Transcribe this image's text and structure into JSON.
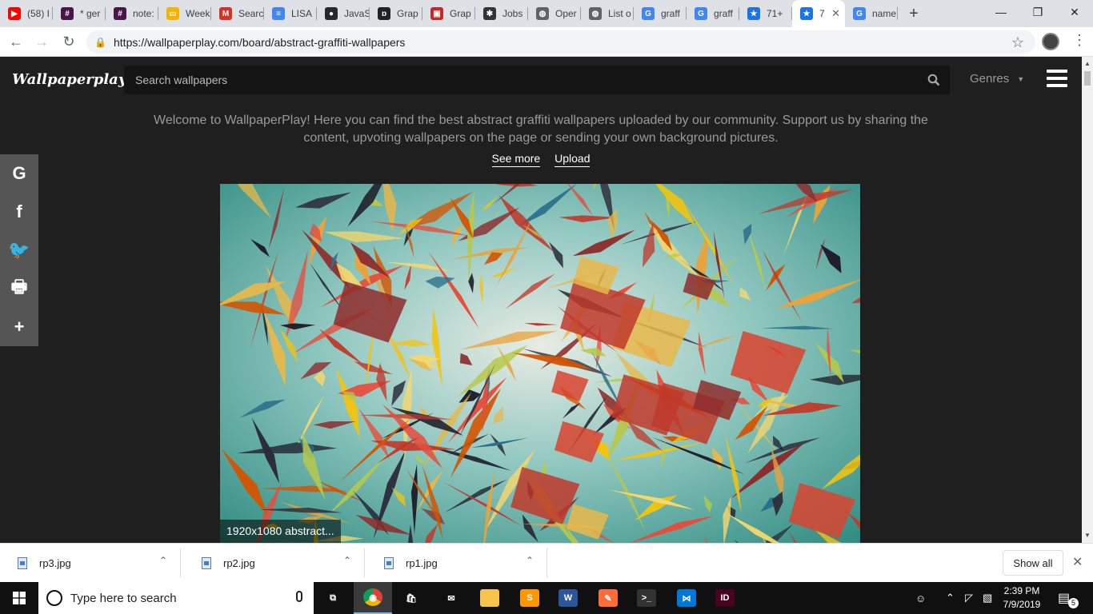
{
  "browser": {
    "tabs": [
      {
        "label": "(58) I",
        "fav_color": "#ff0000",
        "fav_icon": "youtube-icon",
        "fav_glyph": "▶"
      },
      {
        "label": "* ger",
        "fav_color": "#4a154b",
        "fav_icon": "slack-icon",
        "fav_glyph": "#"
      },
      {
        "label": "note:",
        "fav_color": "#4a154b",
        "fav_icon": "slack-icon",
        "fav_glyph": "#"
      },
      {
        "label": "Week",
        "fav_color": "#f4b400",
        "fav_icon": "slides-icon",
        "fav_glyph": "▭"
      },
      {
        "label": "Searc",
        "fav_color": "#d93025",
        "fav_icon": "gmail-icon",
        "fav_glyph": "M"
      },
      {
        "label": "LISA",
        "fav_color": "#4285f4",
        "fav_icon": "docs-icon",
        "fav_glyph": "≡"
      },
      {
        "label": "JavaS",
        "fav_color": "#24292e",
        "fav_icon": "github-icon",
        "fav_glyph": "●"
      },
      {
        "label": "Grap",
        "fav_color": "#222222",
        "fav_icon": "graph-icon",
        "fav_glyph": "ɒ"
      },
      {
        "label": "Grap",
        "fav_color": "#c62828",
        "fav_icon": "graph-icon",
        "fav_glyph": "▣"
      },
      {
        "label": "Jobs",
        "fav_color": "#333333",
        "fav_icon": "jobs-icon",
        "fav_glyph": "✱"
      },
      {
        "label": "Oper",
        "fav_color": "#5f6368",
        "fav_icon": "globe-icon",
        "fav_glyph": "◍"
      },
      {
        "label": "List o",
        "fav_color": "#5f6368",
        "fav_icon": "globe-icon",
        "fav_glyph": "◍"
      },
      {
        "label": "graff",
        "fav_color": "#4285f4",
        "fav_icon": "google-icon",
        "fav_glyph": "G"
      },
      {
        "label": "graff",
        "fav_color": "#4285f4",
        "fav_icon": "google-icon",
        "fav_glyph": "G"
      },
      {
        "label": "71+",
        "fav_color": "#1a73e8",
        "fav_icon": "star-icon",
        "fav_glyph": "★"
      },
      {
        "label": "7",
        "fav_color": "#1a73e8",
        "fav_icon": "star-icon",
        "fav_glyph": "★",
        "active": true
      },
      {
        "label": "name",
        "fav_color": "#4285f4",
        "fav_icon": "google-icon",
        "fav_glyph": "G"
      }
    ],
    "url": "https://wallpaperplay.com/board/abstract-graffiti-wallpapers"
  },
  "site": {
    "logo": "Wallpaperplay",
    "search_placeholder": "Search wallpapers",
    "genres_label": "Genres",
    "welcome_text": "Welcome to WallpaperPlay! Here you can find the best abstract graffiti wallpapers uploaded by our community. Support us by sharing the content, upvoting wallpapers on the page or sending your own background pictures.",
    "see_more": "See more",
    "upload": "Upload",
    "share_buttons": [
      {
        "name": "google-share-icon",
        "glyph": "G"
      },
      {
        "name": "facebook-share-icon",
        "glyph": "f"
      },
      {
        "name": "twitter-share-icon",
        "glyph": "🐦"
      },
      {
        "name": "print-icon",
        "glyph": "🖶"
      },
      {
        "name": "more-share-icon",
        "glyph": "+"
      }
    ],
    "wallpaper_caption": "1920x1080 abstract..."
  },
  "downloads": {
    "files": [
      "rp3.jpg",
      "rp2.jpg",
      "rp1.jpg"
    ],
    "show_all": "Show all"
  },
  "taskbar": {
    "search_placeholder": "Type here to search",
    "time": "2:39 PM",
    "date": "7/9/2019",
    "notification_count": "5",
    "apps": [
      {
        "name": "task-view-icon",
        "color": "#101010",
        "glyph": "⧉"
      },
      {
        "name": "chrome-icon",
        "color": "#db4437",
        "glyph": "◉",
        "active": true
      },
      {
        "name": "store-icon",
        "color": "#101010",
        "glyph": "🛍"
      },
      {
        "name": "mail-icon",
        "color": "#101010",
        "glyph": "✉"
      },
      {
        "name": "file-explorer-icon",
        "color": "#f8c44d",
        "glyph": ""
      },
      {
        "name": "sublime-icon",
        "color": "#ff9800",
        "glyph": "S"
      },
      {
        "name": "word-icon",
        "color": "#2b579a",
        "glyph": "W"
      },
      {
        "name": "postman-icon",
        "color": "#ff6c37",
        "glyph": "✎"
      },
      {
        "name": "terminal-icon",
        "color": "#333333",
        "glyph": ">_"
      },
      {
        "name": "vscode-icon",
        "color": "#0078d7",
        "glyph": "⋈"
      },
      {
        "name": "indesign-icon",
        "color": "#49021f",
        "glyph": "ID"
      }
    ]
  }
}
